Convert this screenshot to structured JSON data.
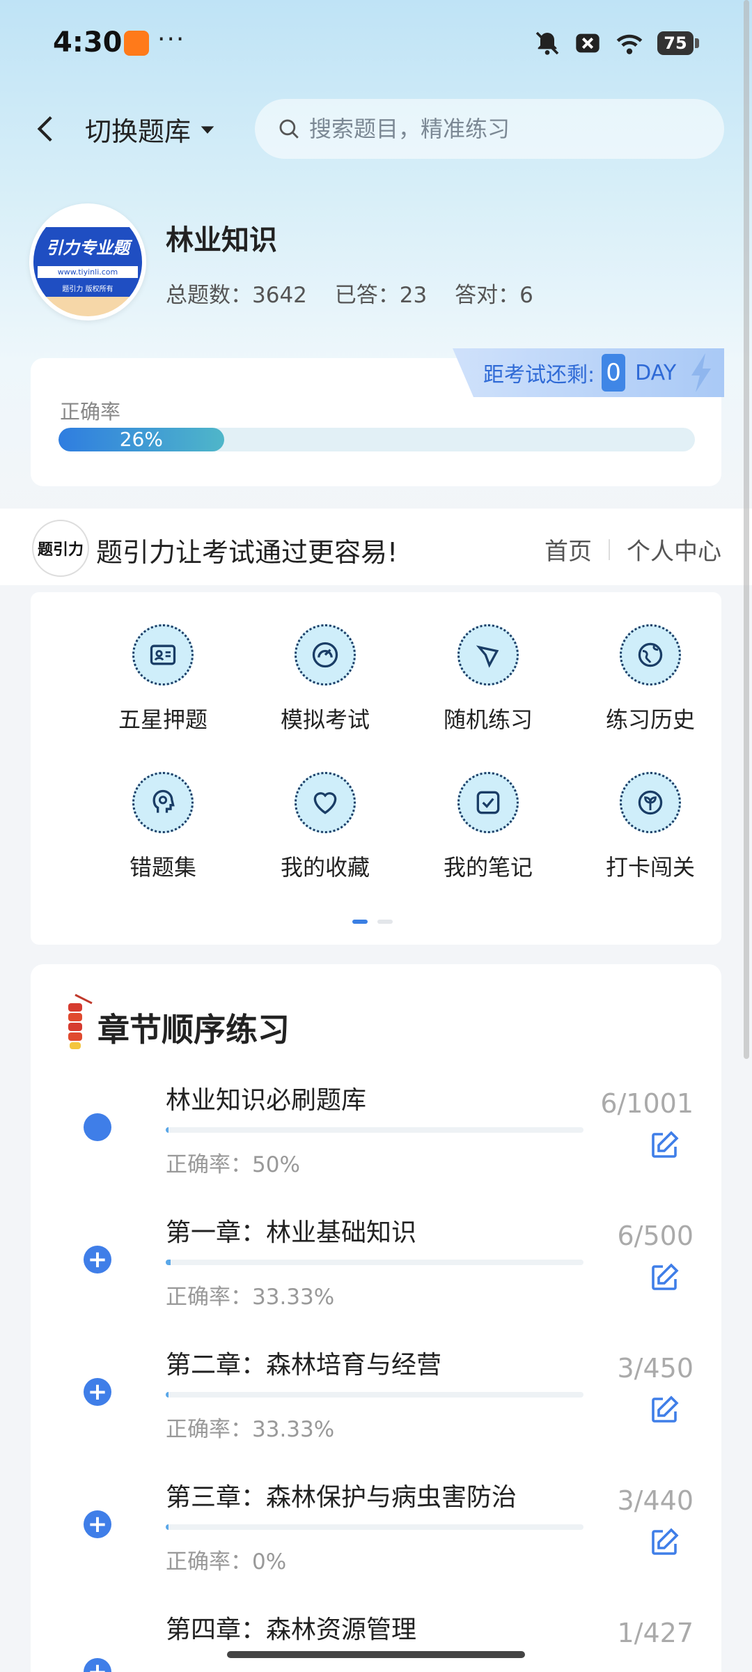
{
  "status_bar": {
    "time": "4:30",
    "more": "···",
    "battery": "75"
  },
  "header": {
    "switch_label": "切换题库",
    "search_placeholder": "搜索题目，精准练习"
  },
  "bank": {
    "logo_title": "引力专业题",
    "logo_url": "www.tiyinli.com",
    "logo_footer": "题引力 版权所有",
    "title": "林业知识",
    "stats": {
      "total": "总题数：3642",
      "answered": "已答：23",
      "correct": "答对：6"
    }
  },
  "countdown": {
    "label": "距考试还剩:",
    "days": "0",
    "unit": "DAY"
  },
  "accuracy": {
    "label": "正确率",
    "value_text": "26%",
    "value": 26
  },
  "slogan": {
    "logo_text": "题引力",
    "text": "题引力让考试通过更容易!",
    "home_link": "首页",
    "profile_link": "个人中心"
  },
  "grid": {
    "items": [
      {
        "label": "五星押题",
        "icon": "id-card-icon"
      },
      {
        "label": "模拟考试",
        "icon": "gauge-icon"
      },
      {
        "label": "随机练习",
        "icon": "shuffle-icon"
      },
      {
        "label": "练习历史",
        "icon": "globe-icon"
      },
      {
        "label": "错题集",
        "icon": "head-icon"
      },
      {
        "label": "我的收藏",
        "icon": "heart-icon"
      },
      {
        "label": "我的笔记",
        "icon": "note-check-icon"
      },
      {
        "label": "打卡闯关",
        "icon": "leaf-icon"
      }
    ],
    "page": 1,
    "pages": 2
  },
  "chapters": {
    "title": "章节顺序练习",
    "rows": [
      {
        "name": "林业知识必刷题库",
        "accuracy": "正确率：50%",
        "count": "6/1001",
        "progress": 0.006,
        "state": "dot"
      },
      {
        "name": "第一章：林业基础知识",
        "accuracy": "正确率：33.33%",
        "count": "6/500",
        "progress": 0.012,
        "state": "plus"
      },
      {
        "name": "第二章：森林培育与经营",
        "accuracy": "正确率：33.33%",
        "count": "3/450",
        "progress": 0.007,
        "state": "plus"
      },
      {
        "name": "第三章：森林保护与病虫害防治",
        "accuracy": "正确率：0%",
        "count": "3/440",
        "progress": 0.007,
        "state": "plus"
      },
      {
        "name": "第四章：森林资源管理",
        "accuracy": "",
        "count": "1/427",
        "progress": 0.002,
        "state": "plus"
      }
    ]
  },
  "colors": {
    "accent": "#3f7ee8",
    "progress_start": "#2f7de0",
    "progress_end": "#4fb6c9"
  }
}
